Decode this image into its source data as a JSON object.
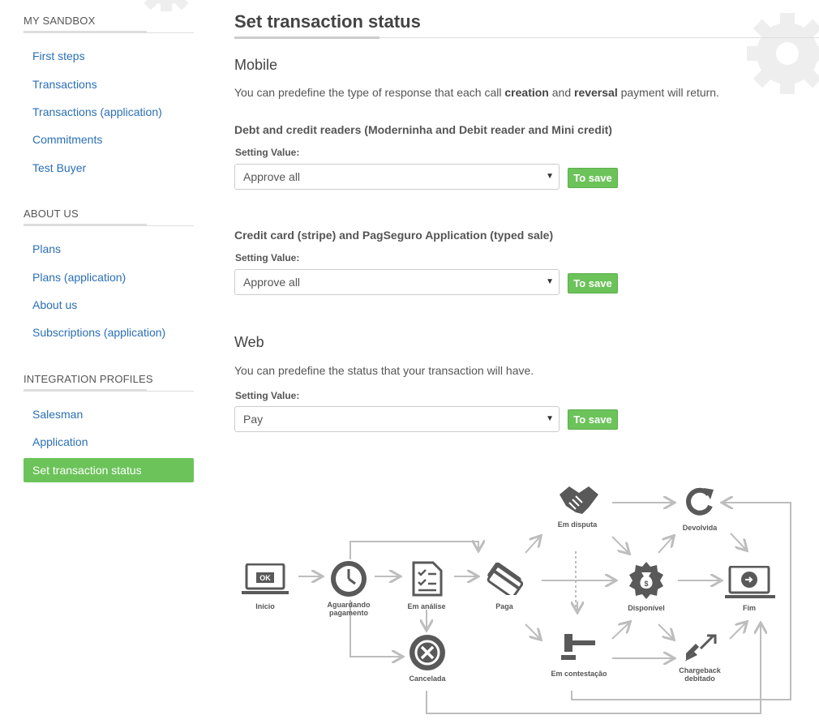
{
  "sidebar": {
    "sections": [
      {
        "title": "MY SANDBOX",
        "items": [
          "First steps",
          "Transactions",
          "Transactions (application)",
          "Commitments",
          "Test Buyer"
        ]
      },
      {
        "title": "ABOUT US",
        "items": [
          "Plans",
          "Plans (application)",
          "About us",
          "Subscriptions (application)"
        ]
      },
      {
        "title": "INTEGRATION PROFILES",
        "items": [
          "Salesman",
          "Application",
          "Set transaction status"
        ]
      }
    ],
    "active_item": "Set transaction status"
  },
  "page": {
    "title": "Set transaction status"
  },
  "mobile": {
    "title": "Mobile",
    "desc_pre": "You can predefine the type of response that each call ",
    "desc_b1": "creation",
    "desc_mid": " and ",
    "desc_b2": "reversal",
    "desc_post": " payment will return.",
    "group1": {
      "title": "Debt and credit readers (Moderninha and Debit reader and Mini credit)",
      "label": "Setting Value:",
      "value": "Approve all",
      "button": "To save"
    },
    "group2": {
      "title": "Credit card (stripe) and PagSeguro Application (typed sale)",
      "label": "Setting Value:",
      "value": "Approve all",
      "button": "To save"
    }
  },
  "web": {
    "title": "Web",
    "desc": "You can predefine the status that your transaction will have.",
    "label": "Setting Value:",
    "value": "Pay",
    "button": "To save"
  },
  "flow": {
    "inicio": "Início",
    "inicio_badge": "OK",
    "aguardando": "Aguardando pagamento",
    "em_analise": "Em análise",
    "paga": "Paga",
    "cancelada": "Cancelada",
    "em_disputa": "Em disputa",
    "devolvida": "Devolvida",
    "disponivel": "Disponível",
    "fim": "Fim",
    "em_contestacao": "Em contestação",
    "chargeback": "Chargeback debitado"
  },
  "colors": {
    "accent_green": "#6cc35a",
    "link_blue": "#2a6fb5",
    "icon_gray": "#595959",
    "arrow_gray": "#bdbdbd"
  }
}
